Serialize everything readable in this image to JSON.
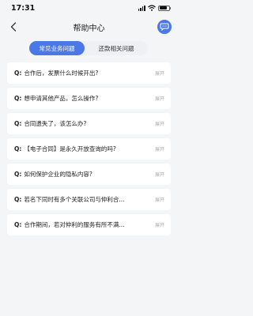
{
  "status_bar": {
    "time": "17:31",
    "battery_level": 0.85
  },
  "header": {
    "title": "帮助中心",
    "back_icon": "chevron-left-icon",
    "chat_icon": "chat-bubble-icon"
  },
  "tabs": [
    {
      "label": "常见业务问题",
      "active": true
    },
    {
      "label": "还款相关问题",
      "active": false
    }
  ],
  "faq": {
    "prefix": "Q:",
    "expand_label": "展开",
    "items": [
      {
        "question": "合作后，发票什么时候开出?"
      },
      {
        "question": "想申请其他产品，怎么操作?"
      },
      {
        "question": "合同遗失了，该怎么办?"
      },
      {
        "question": "【电子合同】是永久开放查询的吗?"
      },
      {
        "question": "如何保护企业的隐私内容?"
      },
      {
        "question": "若名下同时有多个关联公司与仲利合..."
      },
      {
        "question": "合作期间，若对仲利的服务有所不满..."
      }
    ]
  },
  "colors": {
    "accent": "#4a78e6",
    "background": "#f4f5f7",
    "card": "#ffffff"
  }
}
